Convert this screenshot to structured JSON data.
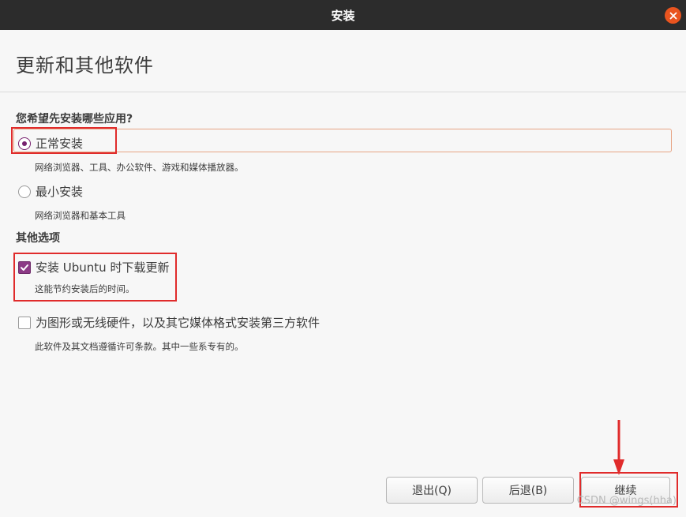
{
  "window": {
    "title": "安装",
    "close_icon": "close-icon",
    "close_color": "#e9541f"
  },
  "header": {
    "title": "更新和其他软件"
  },
  "install_type": {
    "question": "您希望先安装哪些应用?",
    "options": [
      {
        "label": "正常安装",
        "description": "网络浏览器、工具、办公软件、游戏和媒体播放器。",
        "selected": true
      },
      {
        "label": "最小安装",
        "description": "网络浏览器和基本工具",
        "selected": false
      }
    ]
  },
  "other_options": {
    "heading": "其他选项",
    "items": [
      {
        "label": "安装 Ubuntu 时下载更新",
        "description": "这能节约安装后的时间。",
        "checked": true
      },
      {
        "label": "为图形或无线硬件，以及其它媒体格式安装第三方软件",
        "description": "此软件及其文档遵循许可条款。其中一些系专有的。",
        "checked": false
      }
    ]
  },
  "buttons": {
    "quit": "退出(Q)",
    "back": "后退(B)",
    "continue": "继续"
  },
  "watermark": "CSDN @wings(hha)",
  "colors": {
    "accent": "#77216f",
    "annotation_red": "#e02b2b",
    "titlebar": "#2c2c2c"
  }
}
